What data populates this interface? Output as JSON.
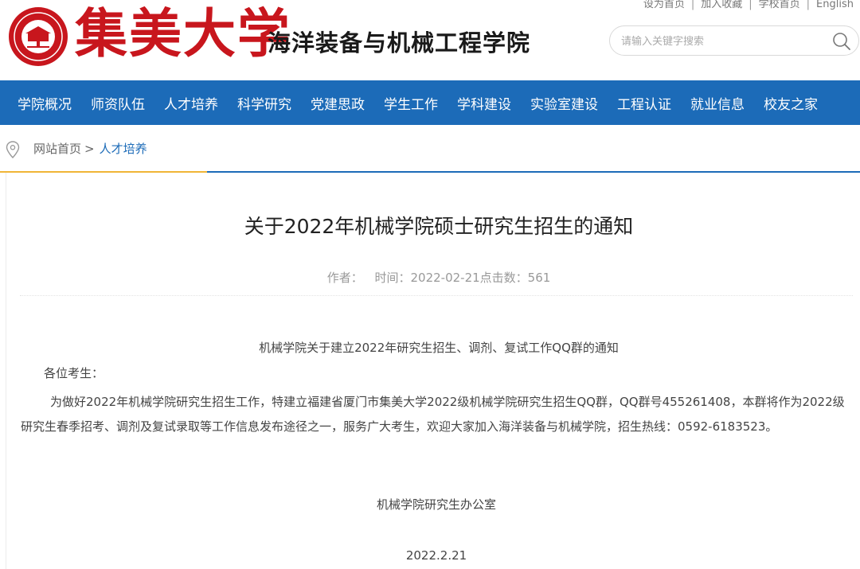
{
  "header": {
    "logo_text": "集美大学",
    "seal_text": "JIMEI UNIVERSITY",
    "school_name": "海洋装备与机械工程学院",
    "top_links": [
      "设为首页",
      "加入收藏",
      "学校首页",
      "English"
    ],
    "search_placeholder": "请输入关键字搜索",
    "brand_color": "#c8161d"
  },
  "nav": {
    "items": [
      "学院概况",
      "师资队伍",
      "人才培养",
      "科学研究",
      "党建思政",
      "学生工作",
      "学科建设",
      "实验室建设",
      "工程认证",
      "就业信息",
      "校友之家"
    ],
    "background": "#1c6bb8"
  },
  "breadcrumb": {
    "home": "网站首页",
    "separator": ">",
    "current": "人才培养"
  },
  "article": {
    "title": "关于2022年机械学院硕士研究生招生的通知",
    "meta": {
      "author_label": "作者：",
      "time_label": "时间：2022-02-21",
      "clicks_label": "点击数：561"
    },
    "heading": "机械学院关于建立2022年研究生招生、调剂、复试工作QQ群的通知",
    "greeting": "各位考生：",
    "body": "为做好2022年机械学院研究生招生工作，特建立福建省厦门市集美大学2022级机械学院研究生招生QQ群，QQ群号455261408，本群将作为2022级研究生春季招考、调剂及复试录取等工作信息发布途径之一，服务广大考生，欢迎大家加入海洋装备与机械学院，招生热线：0592-6183523。",
    "office": "机械学院研究生办公室",
    "date": "2022.2.21"
  }
}
